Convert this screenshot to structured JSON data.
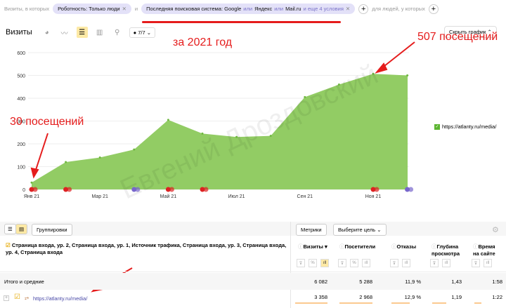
{
  "filters": {
    "prefix": "Визиты, в которых",
    "chip1": "Роботность: Только люди",
    "and": "и",
    "chip2_main": "Последняя поисковая система: Google",
    "or1": "или",
    "yandex": "Яндекс",
    "or2": "или",
    "mail": "Mail.ru",
    "more": "и еще 4 условия",
    "suffix": "для людей, у которых"
  },
  "toolbar": {
    "title": "Визиты",
    "segments": "7/7",
    "hide_chart": "Скрыть график"
  },
  "annotations": {
    "year": "за 2021 год",
    "max": "507 посещений",
    "min": "30 посещений"
  },
  "chart_data": {
    "type": "area",
    "title": "Визиты",
    "x": [
      "Янв 21",
      "Фев 21",
      "Мар 21",
      "Апр 21",
      "Май 21",
      "Июн 21",
      "Июл 21",
      "Авг 21",
      "Сен 21",
      "Окт 21",
      "Ноя 21",
      "Дек 21"
    ],
    "xticks": [
      "Янв 21",
      "Мар 21",
      "Май 21",
      "Июл 21",
      "Сен 21",
      "Ноя 21"
    ],
    "series": [
      {
        "name": "https://atlanty.ru/media/",
        "values": [
          30,
          120,
          140,
          175,
          305,
          245,
          230,
          235,
          405,
          460,
          507,
          500
        ],
        "color": "#92cc64"
      }
    ],
    "yticks": [
      "0",
      "100",
      "200",
      "300",
      "400",
      "500",
      "600"
    ],
    "ylim": [
      0,
      600
    ],
    "grid": true,
    "legend": "right"
  },
  "table": {
    "groupings": "Группировки",
    "metrics": "Метрики",
    "goal": "Выберите цель",
    "dimensions": "Страница входа, ур. 2, Страница входа, ур. 1, Источник трафика, Страница входа, ур. 3, Страница входа, ур. 4, Страница входа",
    "columns": [
      {
        "l1": "Визиты ▾",
        "l2": ""
      },
      {
        "l1": "Посетители",
        "l2": ""
      },
      {
        "l1": "Отказы",
        "l2": ""
      },
      {
        "l1": "Глубина",
        "l2": "просмотра"
      },
      {
        "l1": "Время",
        "l2": "на сайте"
      }
    ],
    "totals": {
      "label": "Итого и средние",
      "values": [
        "6 082",
        "5 288",
        "11,9 %",
        "1,43",
        "1:58"
      ]
    },
    "rows": [
      {
        "label": "https://atlanty.ru/media/",
        "values": [
          "3 358",
          "2 968",
          "12,9 %",
          "1,19",
          "1:22"
        ]
      }
    ]
  }
}
